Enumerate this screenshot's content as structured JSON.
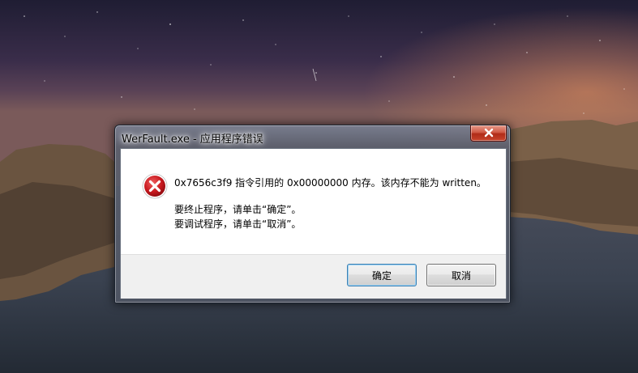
{
  "dialog": {
    "title": "WerFault.exe - 应用程序错误",
    "message_line1": "0x7656c3f9 指令引用的 0x00000000 内存。该内存不能为 written。",
    "message_line2": "要终止程序，请单击“确定”。",
    "message_line3": "要调试程序，请单击“取消”。",
    "ok_label": "确定",
    "cancel_label": "取消",
    "close_icon": "close-icon",
    "error_icon": "error-icon"
  },
  "colors": {
    "close_button": "#c8442c",
    "error_icon": "#c8181e",
    "ok_focus_border": "#3c7fb1"
  }
}
